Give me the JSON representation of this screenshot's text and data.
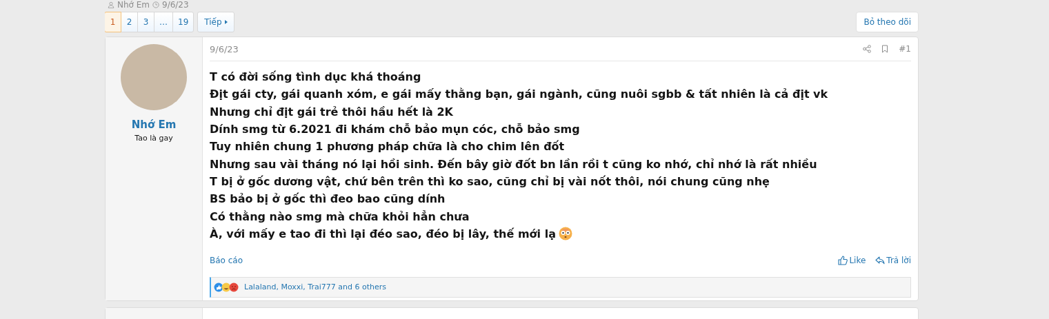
{
  "thread_meta": {
    "author": "Nhớ Em",
    "date": "9/6/23"
  },
  "pagination": {
    "pages": [
      {
        "label": "1",
        "selected": true
      },
      {
        "label": "2",
        "selected": false
      },
      {
        "label": "3",
        "selected": false
      },
      {
        "label": "…",
        "selected": false
      },
      {
        "label": "19",
        "selected": false
      }
    ],
    "next": "Tiếp"
  },
  "unwatch_button": "Bỏ theo dõi",
  "post": {
    "author": {
      "name": "Nhớ Em",
      "title": "Tao là gay"
    },
    "date": "9/6/23",
    "number": "#1",
    "lines": [
      "T có đời sống tình dục khá thoáng",
      "Địt gái cty, gái quanh xóm, e gái mấy thằng bạn, gái ngành, cũng nuôi sgbb & tất nhiên là cả địt vk",
      "Nhưng chỉ địt gái trẻ thôi hầu hết là 2K",
      "Dính smg từ 6.2021 đi khám chỗ bảo mụn cóc, chỗ bảo smg",
      "Tuy nhiên chung 1 phương pháp chữa là cho chim lên đốt",
      "Nhưng sau vài tháng nó lại hồi sinh. Đến bây giờ đốt bn lần rồi t cũng ko nhớ, chỉ nhớ là rất nhiều",
      "T bị ở gốc dương vật, chứ bên trên thì ko sao, cũng chỉ bị vài nốt thôi, nói chung cũng nhẹ",
      "BS bảo bị ở gốc thì đeo bao cũng dính",
      "Có thằng nào smg mà chữa khỏi hẳn chưa",
      "À, với mấy e tao đi thì lại đéo sao, đéo bị lây, thế mới lạ"
    ],
    "report": "Báo cáo",
    "like": "Like",
    "reply": "Trả lời",
    "reactions": "Lalaland, Moxxi, Trai777 and 6 others"
  }
}
